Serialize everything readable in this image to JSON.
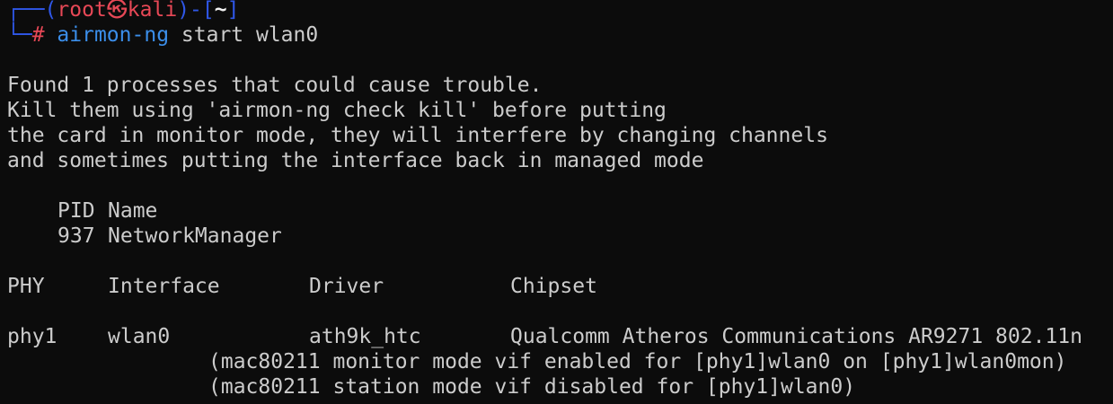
{
  "prompt": {
    "corner_top": "┌──",
    "open_paren": "(",
    "user": "root",
    "at_symbol": "㉿",
    "host": "kali",
    "close_paren": ")",
    "dash": "-",
    "open_bracket": "[",
    "cwd": "~",
    "close_bracket": "]",
    "corner_bottom": "└─",
    "hash": "#",
    "command": "airmon-ng",
    "args": "start wlan0"
  },
  "output": {
    "warning_lines": [
      "Found 1 processes that could cause trouble.",
      "Kill them using 'airmon-ng check kill' before putting",
      "the card in monitor mode, they will interfere by changing channels",
      "and sometimes putting the interface back in managed mode"
    ],
    "process_table": {
      "headers": [
        "PID",
        "Name"
      ],
      "rows": [
        [
          "937",
          "NetworkManager"
        ]
      ]
    },
    "interface_table": {
      "headers": [
        "PHY",
        "Interface",
        "Driver",
        "Chipset"
      ],
      "rows": [
        [
          "phy1",
          "wlan0",
          "ath9k_htc",
          "Qualcomm Atheros Communications AR9271 802.11n"
        ]
      ],
      "notes": [
        "(mac80211 monitor mode vif enabled for [phy1]wlan0 on [phy1]wlan0mon)",
        "(mac80211 station mode vif disabled for [phy1]wlan0)"
      ]
    }
  },
  "colors": {
    "background": "#0c0c0c",
    "text": "#cccccc",
    "prompt_frame": "#2f57e8",
    "prompt_user_host": "#e74856",
    "command": "#3b8eea"
  }
}
